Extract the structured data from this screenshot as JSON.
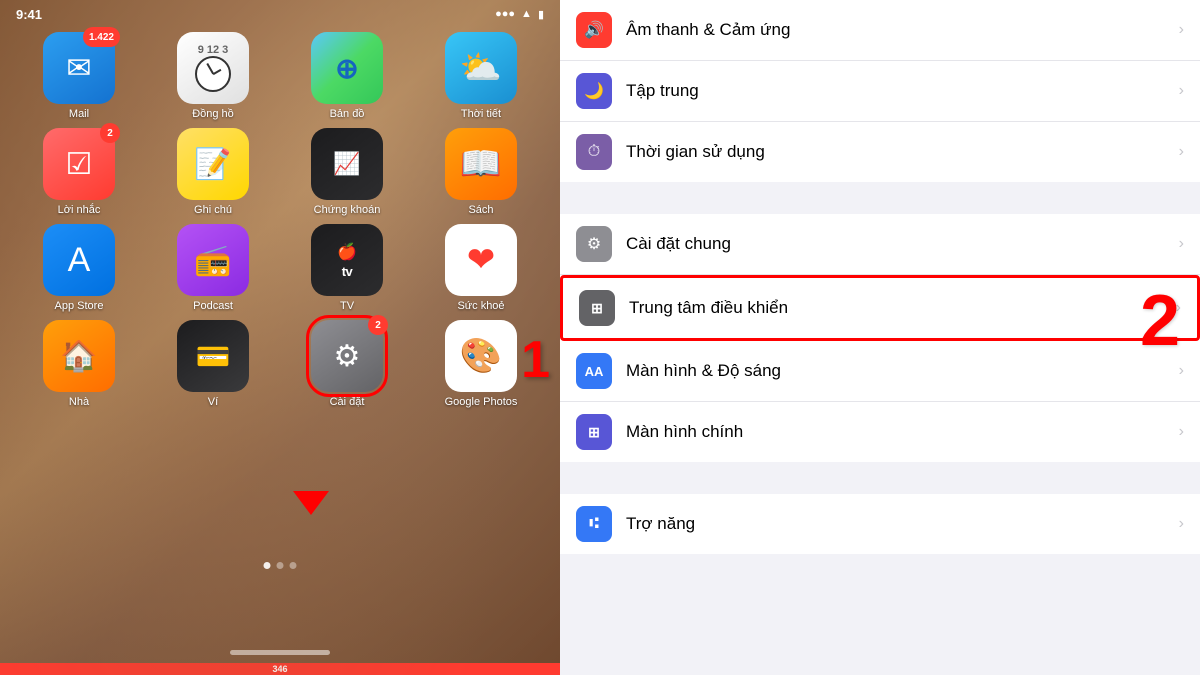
{
  "left": {
    "statusBar": {
      "time": "9:41",
      "signals": "● ● ●"
    },
    "apps": [
      [
        {
          "name": "Mail",
          "label": "Mail",
          "icon": "mail",
          "badge": "1.422"
        },
        {
          "name": "Clock",
          "label": "Đồng hồ",
          "icon": "clock",
          "badge": ""
        },
        {
          "name": "Maps",
          "label": "Bản đồ",
          "icon": "maps",
          "badge": ""
        },
        {
          "name": "Weather",
          "label": "Thời tiết",
          "icon": "weather",
          "badge": ""
        }
      ],
      [
        {
          "name": "Reminders",
          "label": "Lời nhắc",
          "icon": "reminder",
          "badge": "2"
        },
        {
          "name": "Notes",
          "label": "Ghi chú",
          "icon": "notes",
          "badge": ""
        },
        {
          "name": "Stocks",
          "label": "Chứng khoán",
          "icon": "stocks",
          "badge": ""
        },
        {
          "name": "Books",
          "label": "Sách",
          "icon": "books",
          "badge": ""
        }
      ],
      [
        {
          "name": "AppStore",
          "label": "App Store",
          "icon": "appstore",
          "badge": ""
        },
        {
          "name": "Podcasts",
          "label": "Podcast",
          "icon": "podcasts",
          "badge": ""
        },
        {
          "name": "AppleTV",
          "label": "TV",
          "icon": "appletv",
          "badge": ""
        },
        {
          "name": "Health",
          "label": "Sức khoẻ",
          "icon": "health",
          "badge": ""
        }
      ],
      [
        {
          "name": "Home",
          "label": "Nhà",
          "icon": "home",
          "badge": ""
        },
        {
          "name": "Wallet",
          "label": "Ví",
          "icon": "wallet",
          "badge": ""
        },
        {
          "name": "Settings",
          "label": "Cài đặt",
          "icon": "settings",
          "badge": "2",
          "highlighted": true
        },
        {
          "name": "GooglePhotos",
          "label": "Google Photos",
          "icon": "photos",
          "badge": ""
        }
      ]
    ],
    "annotation": {
      "number": "1",
      "arrowLabel": "↓"
    }
  },
  "right": {
    "items": [
      {
        "id": "sound",
        "label": "Âm thanh & Cảm ứng",
        "iconClass": "si-sound",
        "iconText": "🔊"
      },
      {
        "id": "focus",
        "label": "Tập trung",
        "iconClass": "si-focus",
        "iconText": "🌙"
      },
      {
        "id": "screentime",
        "label": "Thời gian sử dụng",
        "iconClass": "si-screentime",
        "iconText": "⏳"
      },
      {
        "id": "general",
        "label": "Cài đặt chung",
        "iconClass": "si-general",
        "iconText": "⚙️"
      },
      {
        "id": "control",
        "label": "Trung tâm điều khiển",
        "iconClass": "si-control",
        "iconText": "⊞",
        "highlighted": true
      },
      {
        "id": "display",
        "label": "Màn hình & Độ sáng",
        "iconClass": "si-display",
        "iconText": "AA"
      },
      {
        "id": "homescreen",
        "label": "Màn hình chính",
        "iconClass": "si-homescreen",
        "iconText": "⊞"
      }
    ],
    "annotation": {
      "number": "2"
    }
  }
}
